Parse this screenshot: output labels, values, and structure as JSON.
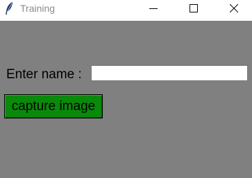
{
  "window": {
    "title": "Training",
    "icon": "feather-icon",
    "controls": {
      "minimize_icon": "minimize-icon",
      "maximize_icon": "maximize-icon",
      "close_icon": "close-icon"
    },
    "background_color": "#808080"
  },
  "form": {
    "name_label": "Enter name :",
    "name_value": "",
    "name_placeholder": "",
    "capture_button_label": "capture image",
    "capture_button_color": "#0a8a0a"
  }
}
